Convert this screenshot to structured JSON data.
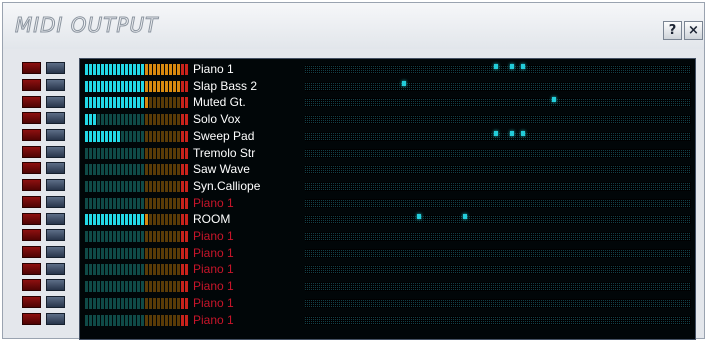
{
  "window": {
    "title": "MIDI OUTPUT",
    "help_label": "?",
    "close_label": "×"
  },
  "colors": {
    "meter_lit": "#23d9e6",
    "meter_dim": "#0f4a47",
    "meter_orange": "#d98a10",
    "meter_orange_dim": "#5a3b07",
    "meter_red": "#c9221b",
    "name_active": "#ffffff",
    "name_inactive": "#c8152a",
    "note_on": "#29f0ff"
  },
  "channels": [
    {
      "name": "Piano 1",
      "active": true,
      "level": 1.0,
      "notes": [
        0.49,
        0.53,
        0.56
      ]
    },
    {
      "name": "Slap Bass 2",
      "active": true,
      "level": 0.92,
      "notes": [
        0.25
      ]
    },
    {
      "name": "Muted Gt.",
      "active": true,
      "level": 0.62,
      "notes": [
        0.64
      ]
    },
    {
      "name": "Solo Vox",
      "active": true,
      "level": 0.13,
      "notes": []
    },
    {
      "name": "Sweep Pad",
      "active": true,
      "level": 0.33,
      "notes": [
        0.49,
        0.53,
        0.56
      ]
    },
    {
      "name": "Tremolo Str",
      "active": true,
      "level": 0,
      "notes": []
    },
    {
      "name": "Saw Wave",
      "active": true,
      "level": 0,
      "notes": []
    },
    {
      "name": "Syn.Calliope",
      "active": true,
      "level": 0,
      "notes": []
    },
    {
      "name": "Piano 1",
      "active": false,
      "level": 0,
      "notes": []
    },
    {
      "name": "ROOM",
      "active": true,
      "level": 0.62,
      "notes": [
        0.29,
        0.41
      ]
    },
    {
      "name": "Piano 1",
      "active": false,
      "level": 0,
      "notes": []
    },
    {
      "name": "Piano 1",
      "active": false,
      "level": 0,
      "notes": []
    },
    {
      "name": "Piano 1",
      "active": false,
      "level": 0,
      "notes": []
    },
    {
      "name": "Piano 1",
      "active": false,
      "level": 0,
      "notes": []
    },
    {
      "name": "Piano 1",
      "active": false,
      "level": 0,
      "notes": []
    },
    {
      "name": "Piano 1",
      "active": false,
      "level": 0,
      "notes": []
    }
  ]
}
